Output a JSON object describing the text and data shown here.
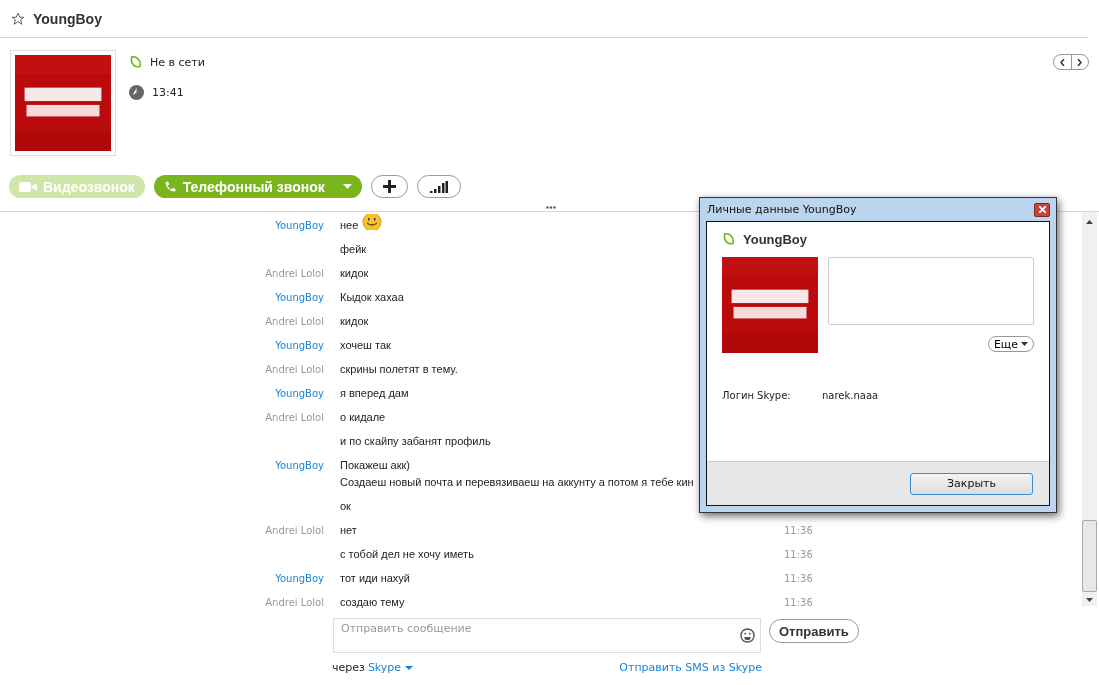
{
  "header": {
    "title": "YoungBoy",
    "favorite": false
  },
  "profile": {
    "status": "Не в сети",
    "local_time": "13:41"
  },
  "actions": [
    {
      "kind": "video",
      "label": "Видеозвонок",
      "disabled": true
    },
    {
      "kind": "call",
      "label": "Телефонный звонок",
      "disabled": false
    },
    {
      "kind": "add"
    },
    {
      "kind": "quality"
    }
  ],
  "messages": [
    {
      "sender": "YoungBoy",
      "kind": "contact",
      "lines": [
        "нее"
      ],
      "emoticon": true
    },
    {
      "kind": "continued",
      "lines": [
        "фейк"
      ]
    },
    {
      "sender": "Andrei Lolol",
      "kind": "self",
      "lines": [
        "кидок"
      ]
    },
    {
      "sender": "YoungBoy",
      "kind": "contact",
      "lines": [
        "Кыдок хахаа"
      ]
    },
    {
      "sender": "Andrei Lolol",
      "kind": "self",
      "lines": [
        "кидок"
      ]
    },
    {
      "sender": "YoungBoy",
      "kind": "contact",
      "lines": [
        "хочеш так"
      ]
    },
    {
      "sender": "Andrei Lolol",
      "kind": "self",
      "lines": [
        "скрины полетят в тему."
      ]
    },
    {
      "sender": "YoungBoy",
      "kind": "contact",
      "lines": [
        "я вперед дам"
      ]
    },
    {
      "sender": "Andrei Lolol",
      "kind": "self",
      "lines": [
        "о кидале"
      ]
    },
    {
      "kind": "continued",
      "lines": [
        "и по скайпу забанят профиль"
      ]
    },
    {
      "sender": "YoungBoy",
      "kind": "contact",
      "lines": [
        "Покажеш акк)",
        "Создаеш новый почта и перевязиваеш на аккунту а потом я тебе кин"
      ]
    },
    {
      "kind": "continued",
      "lines": [
        "ок"
      ]
    },
    {
      "sender": "Andrei Lolol",
      "kind": "self",
      "lines": [
        "нет"
      ],
      "time": "11:36"
    },
    {
      "kind": "continued",
      "lines": [
        "с тобой дел не хочу иметь"
      ],
      "time": "11:36"
    },
    {
      "sender": "YoungBoy",
      "kind": "contact",
      "lines": [
        "тот иди нахуй"
      ],
      "time": "11:36"
    },
    {
      "sender": "Andrei Lolol",
      "kind": "self",
      "lines": [
        "создаю тему"
      ],
      "time": "11:36"
    }
  ],
  "composer": {
    "placeholder": "Отправить сообщение",
    "send": "Отправить",
    "via_prefix": "через",
    "via_service": "Skype",
    "sms_link": "Отправить SMS из Skype"
  },
  "dialog": {
    "title": "Личные данные YoungBoy",
    "contact_name": "YoungBoy",
    "more": "Еще",
    "fields": [
      {
        "label": "Логин Skype:",
        "value": "narek.naaa"
      }
    ],
    "close": "Закрыть"
  }
}
